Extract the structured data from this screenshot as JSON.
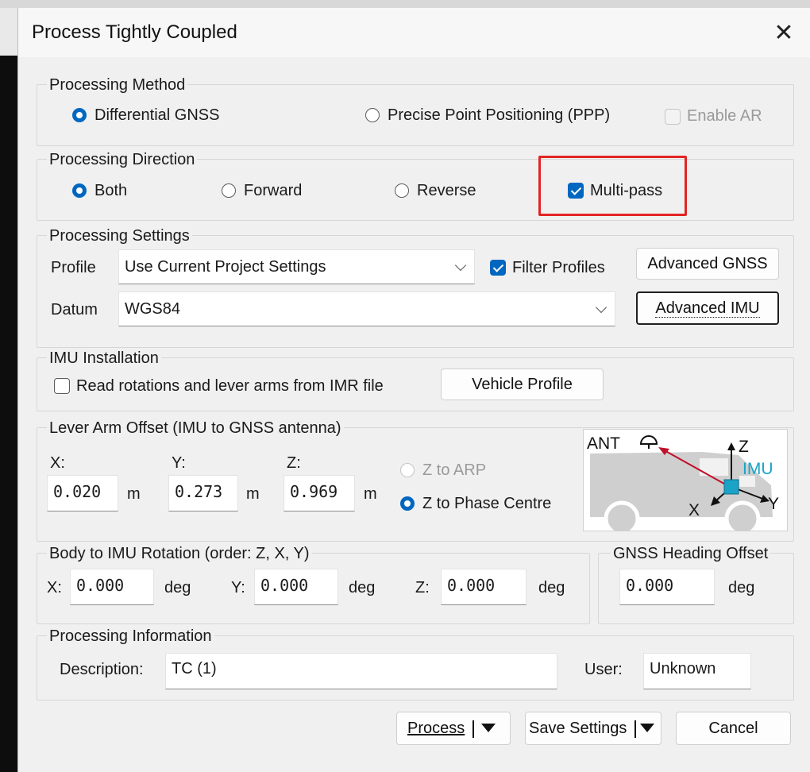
{
  "window": {
    "title": "Process Tightly Coupled"
  },
  "processing_method": {
    "label": "Processing Method",
    "differential_gnss": "Differential GNSS",
    "ppp": "Precise Point Positioning (PPP)",
    "enable_ar": "Enable AR",
    "selected": "Differential GNSS"
  },
  "processing_direction": {
    "label": "Processing Direction",
    "both": "Both",
    "forward": "Forward",
    "reverse": "Reverse",
    "multi_pass": "Multi-pass",
    "selected": "Both",
    "multi_pass_checked": true
  },
  "processing_settings": {
    "label": "Processing Settings",
    "profile_label": "Profile",
    "profile_value": "Use Current Project Settings",
    "filter_profiles": "Filter Profiles",
    "filter_profiles_checked": true,
    "advanced_gnss": "Advanced GNSS",
    "datum_label": "Datum",
    "datum_value": "WGS84",
    "advanced_imu": "Advanced IMU"
  },
  "imu_installation": {
    "label": "IMU Installation",
    "read_rotations": "Read rotations and lever arms from IMR file",
    "read_rotations_checked": false,
    "vehicle_profile": "Vehicle Profile"
  },
  "lever_arm": {
    "label": "Lever Arm Offset (IMU to GNSS antenna)",
    "x_label": "X:",
    "x_value": "0.020",
    "y_label": "Y:",
    "y_value": "0.273",
    "z_label": "Z:",
    "z_value": "0.969",
    "unit": "m",
    "z_to_arp": "Z to ARP",
    "z_to_phase_centre": "Z to Phase Centre",
    "selected": "Z to Phase Centre",
    "diagram": {
      "ant": "ANT",
      "imu": "IMU",
      "x": "X",
      "y": "Y",
      "z": "Z"
    }
  },
  "body_to_imu": {
    "label": "Body to IMU Rotation (order: Z, X, Y)",
    "x_label": "X:",
    "x_value": "0.000",
    "y_label": "Y:",
    "y_value": "0.000",
    "z_label": "Z:",
    "z_value": "0.000",
    "unit": "deg"
  },
  "gnss_heading_offset": {
    "label": "GNSS Heading Offset",
    "value": "0.000",
    "unit": "deg"
  },
  "processing_information": {
    "label": "Processing Information",
    "description_label": "Description:",
    "description_value": "TC (1)",
    "user_label": "User:",
    "user_value": "Unknown"
  },
  "buttons": {
    "process": "Process",
    "save_settings": "Save Settings",
    "cancel": "Cancel"
  },
  "colors": {
    "accent": "#0067c0",
    "highlight": "#e32424",
    "imu": "#1aa3c7",
    "ant_arrow": "#c0102a"
  }
}
